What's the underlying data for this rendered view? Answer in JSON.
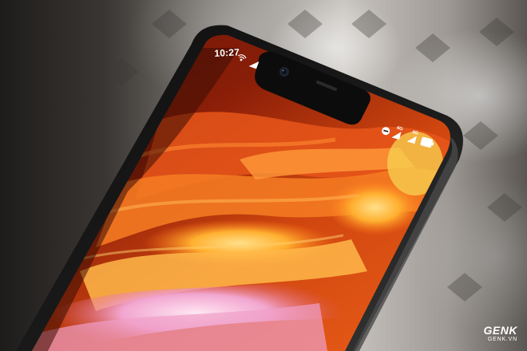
{
  "status_bar": {
    "time": "10:27",
    "left_icons": [
      "hotspot-icon",
      "wifi-calling-icon"
    ],
    "right_icons": [
      "do-not-disturb-icon",
      "signal-4g-icon",
      "signal-4g-icon",
      "battery-icon"
    ],
    "network_label_1": "4G",
    "network_label_2": "4G"
  },
  "watermark": {
    "brand": "GENK",
    "site": "GENK.VN"
  },
  "colors": {
    "wallpaper_deep": "#8a1e08",
    "wallpaper_orange": "#f0641a",
    "wallpaper_glow": "#ffc04a",
    "wallpaper_pink": "#f2a6d0",
    "phone_frame": "#151515"
  }
}
